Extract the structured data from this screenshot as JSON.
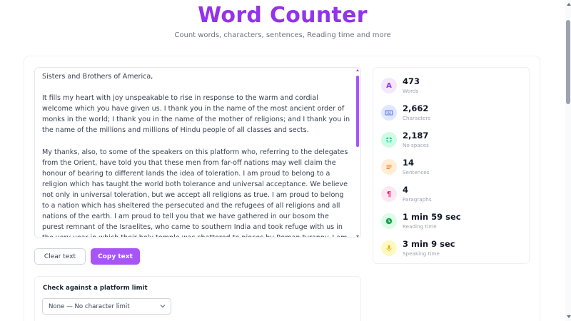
{
  "header": {
    "title": "Word Counter",
    "subtitle": "Count words, characters, sentences, Reading time and more"
  },
  "editor": {
    "text": "Sisters and Brothers of America,\n\nIt fills my heart with joy unspeakable to rise in response to the warm and cordial welcome which you have given us. I thank you in the name of the most ancient order of monks in the world; I thank you in the name of the mother of religions; and I thank you in the name of the millions and millions of Hindu people of all classes and sects.\n\nMy thanks, also, to some of the speakers on this platform who, referring to the delegates from the Orient, have told you that these men from far-off nations may well claim the honour of bearing to different lands the idea of toleration. I am proud to belong to a religion which has taught the world both tolerance and universal acceptance. We believe not only in universal toleration, but we accept all religions as true. I am proud to belong to a nation which has sheltered the persecuted and the refugees of all religions and all nations of the earth. I am proud to tell you that we have gathered in our bosom the purest remnant of the Israelites, who came to southern India and took refuge with us in the very year in which their holy temple was shattered to pieces by Roman tyranny. I am proud to belong to the religion which has sheltered"
  },
  "buttons": {
    "clear_label": "Clear text",
    "copy_label": "Copy text"
  },
  "platform": {
    "label": "Check against a platform limit",
    "selected": "None — No character limit"
  },
  "stats": [
    {
      "value": "473",
      "label": "Words",
      "icon": "letter-a-icon",
      "icon_bg": "#f3e8ff",
      "icon_color": "#9333ea"
    },
    {
      "value": "2,662",
      "label": "Characters",
      "icon": "keyboard-icon",
      "icon_bg": "#e0e7ff",
      "icon_color": "#4f6fe8"
    },
    {
      "value": "2,187",
      "label": "No spaces",
      "icon": "compress-icon",
      "icon_bg": "#d1fae5",
      "icon_color": "#10b981"
    },
    {
      "value": "14",
      "label": "Sentences",
      "icon": "lines-icon",
      "icon_bg": "#ffedd5",
      "icon_color": "#f97316"
    },
    {
      "value": "4",
      "label": "Paragraphs",
      "icon": "pilcrow-icon",
      "icon_bg": "#fce7f3",
      "icon_color": "#db2777"
    },
    {
      "value": "1 min 59 sec",
      "label": "Reading time",
      "icon": "clock-icon",
      "icon_bg": "#dcfce7",
      "icon_color": "#16a34a"
    },
    {
      "value": "3 min 9 sec",
      "label": "Speaking time",
      "icon": "microphone-icon",
      "icon_bg": "#fef9c3",
      "icon_color": "#eab308"
    }
  ]
}
